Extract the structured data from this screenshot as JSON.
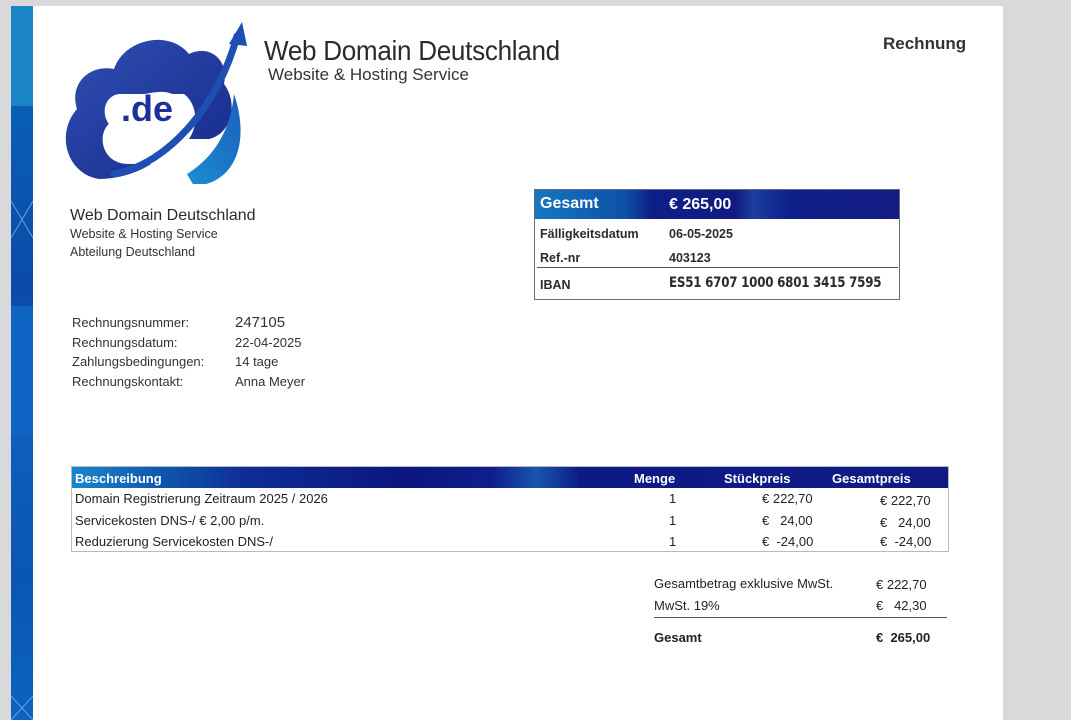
{
  "header": {
    "company_name": "Web Domain Deutschland",
    "tagline": "Website & Hosting Service",
    "document_type": "Rechnung",
    "logo_text": ".de"
  },
  "sender": {
    "name": "Web Domain Deutschland",
    "tagline": "Website & Hosting Service",
    "department": "Abteilung Deutschland"
  },
  "summary": {
    "total_label": "Gesamt",
    "total_value": "€ 265,00",
    "due_label": "Fälligkeitsdatum",
    "due_value": "06-05-2025",
    "ref_label": "Ref.-nr",
    "ref_value": "403123",
    "iban_label": "IBAN",
    "iban_value": "ES51 6707 1000 6801 3415 7595"
  },
  "meta": [
    {
      "label": "Rechnungsnummer:",
      "value": "247105"
    },
    {
      "label": "Rechnungsdatum:",
      "value": "22-04-2025"
    },
    {
      "label": "Zahlungsbedingungen:",
      "value": "14 tage"
    },
    {
      "label": "Rechnungskontakt:",
      "value": "Anna Meyer"
    }
  ],
  "items": {
    "headers": [
      "Beschreibung",
      "Menge",
      "Stückpreis",
      "Gesamtpreis"
    ],
    "rows": [
      {
        "desc": "Domain Registrierung Zeitraum 2025 / 2026",
        "qty": "1",
        "unit": "€ 222,70",
        "total": "€ 222,70"
      },
      {
        "desc": "Servicekosten DNS-/ € 2,00 p/m.",
        "qty": "1",
        "unit": "€   24,00",
        "total": "€   24,00"
      },
      {
        "desc": "Reduzierung Servicekosten DNS-/",
        "qty": "1",
        "unit": "€  -24,00",
        "total": "€  -24,00"
      }
    ]
  },
  "totals": {
    "net_label": "Gesamtbetrag exklusive MwSt.",
    "net_value": "€ 222,70",
    "vat_label": "MwSt. 19%",
    "vat_value": "€   42,30",
    "grand_label": "Gesamt",
    "grand_value": "€  265,00"
  },
  "colors": {
    "brand_dark": "#0e1f88",
    "brand_light": "#1986cc",
    "stripe": "#0b4aa8"
  }
}
